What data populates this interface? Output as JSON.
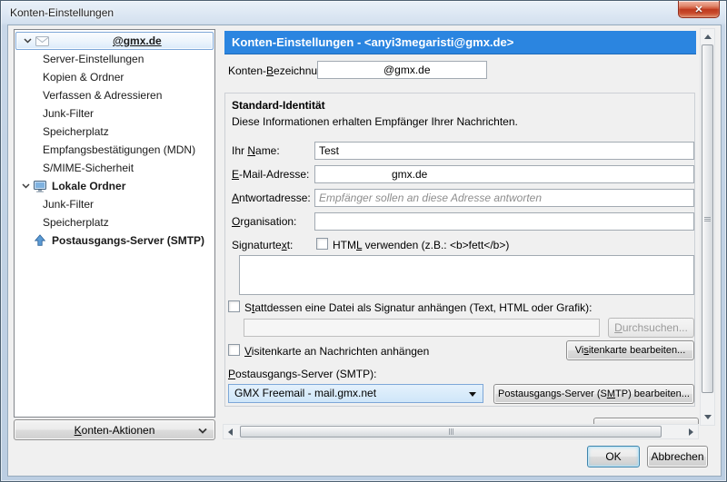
{
  "window": {
    "title": "Konten-Einstellungen"
  },
  "icons": {
    "close_button": "✕",
    "account_expander": "chevron-down",
    "account": "mail-envelope",
    "local_folders": "computer-monitor",
    "smtp": "send-arrow-up",
    "actions_menu": "chevron-down",
    "smtp_dropdown": "triangle-down"
  },
  "sidebar": {
    "tree": [
      {
        "label": "@gmx.de",
        "selected": true,
        "expanded": true
      },
      {
        "label": "Server-Einstellungen"
      },
      {
        "label": "Kopien & Ordner"
      },
      {
        "label": "Verfassen & Adressieren"
      },
      {
        "label": "Junk-Filter"
      },
      {
        "label": "Speicherplatz"
      },
      {
        "label": "Empfangsbestätigungen (MDN)"
      },
      {
        "label": "S/MIME-Sicherheit"
      },
      {
        "label": "Lokale Ordner",
        "expanded": true
      },
      {
        "label": "Junk-Filter"
      },
      {
        "label": "Speicherplatz"
      },
      {
        "label": "Postausgangs-Server (SMTP)"
      }
    ],
    "actions_button": {
      "text": "Konten-Aktionen",
      "u": 0
    }
  },
  "content": {
    "header_title": "Konten-Einstellungen - <anyi3megaristi@gmx.de>",
    "account_label": {
      "text": "Konten-Bezeichnung:",
      "u": 7
    },
    "account_value": "@gmx.de",
    "identity": {
      "section_title": "Standard-Identität",
      "section_desc": "Diese Informationen erhalten Empfänger Ihrer Nachrichten.",
      "name_label": {
        "text": "Ihr Name:",
        "u": 4
      },
      "name_value": "Test",
      "email_label": {
        "text": "E-Mail-Adresse:",
        "u": 0
      },
      "email_value": "gmx.de",
      "reply_label": {
        "text": "Antwortadresse:",
        "u": 0
      },
      "reply_placeholder": "Empfänger sollen an diese Adresse antworten",
      "org_label": {
        "text": "Organisation:",
        "u": 0
      },
      "org_value": "",
      "signature_label": {
        "text": "Signaturtext:",
        "u": 10
      },
      "html_checkbox_label": {
        "text": "HTML verwenden (z.B.: <b>fett</b>)",
        "u": 3
      },
      "signature_text": "",
      "file_checkbox_label": {
        "text": "Stattdessen eine Datei als Signatur anhängen (Text, HTML oder Grafik):",
        "u": 1
      },
      "file_path_value": "",
      "browse_button": {
        "text": "Durchsuchen...",
        "u": 0
      },
      "vcard_checkbox_label": {
        "text": "Visitenkarte an Nachrichten anhängen",
        "u": 0
      },
      "vcard_edit_button": {
        "text": "Visitenkarte bearbeiten...",
        "u": 2
      },
      "smtp_label": {
        "text": "Postausgangs-Server (SMTP):",
        "u": 0
      },
      "smtp_selected": "GMX Freemail - mail.gmx.net",
      "smtp_edit_button": {
        "text": "Postausgangs-Server (SMTP) bearbeiten...",
        "u": 22
      }
    }
  },
  "footer": {
    "ok_button": "OK",
    "cancel_button": "Abbrechen"
  },
  "colors": {
    "header_blue": "#2b85e0",
    "close_red": "#cf5336",
    "selection_border": "#7da7d8"
  }
}
